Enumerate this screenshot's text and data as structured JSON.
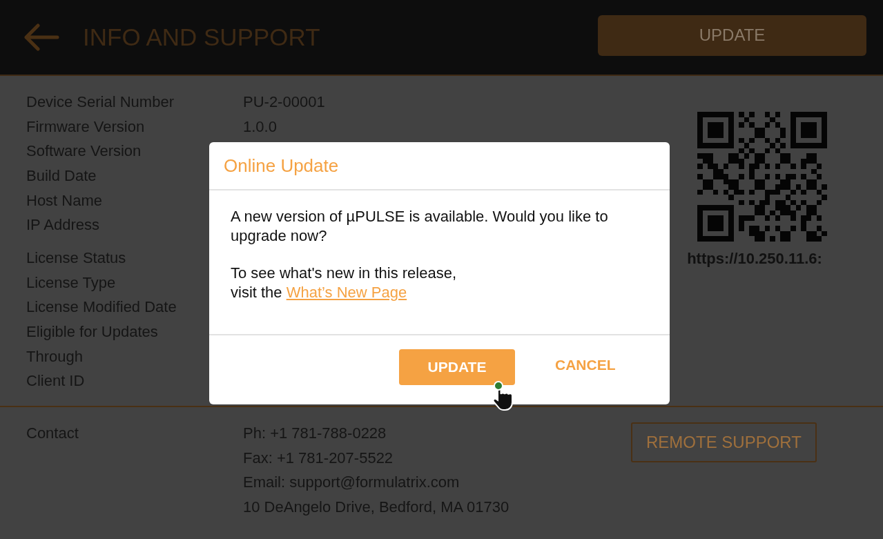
{
  "header": {
    "title": "INFO AND SUPPORT",
    "update_button": "UPDATE"
  },
  "info_groups": [
    [
      {
        "label": "Device Serial Number",
        "value": "PU-2-00001"
      },
      {
        "label": "Firmware Version",
        "value": "1.0.0"
      },
      {
        "label": "Software Version"
      },
      {
        "label": "Build Date"
      },
      {
        "label": "Host Name"
      },
      {
        "label": "IP Address"
      }
    ],
    [
      {
        "label": "License Status"
      },
      {
        "label": "License Type"
      },
      {
        "label": "License Modified Date"
      },
      {
        "label": "Eligible for Updates"
      },
      {
        "label": "Through"
      },
      {
        "label": "Client ID"
      }
    ]
  ],
  "qr": {
    "url": "https://10.250.11.6:"
  },
  "contact": {
    "label": "Contact",
    "lines": [
      "Ph: +1 781-788-0228",
      "Fax: +1 781-207-5522",
      "Email: support@formulatrix.com",
      "10 DeAngelo Drive, Bedford, MA 01730"
    ],
    "remote_support_button": "REMOTE SUPPORT"
  },
  "dialog": {
    "title": "Online Update",
    "message": "A new version of µPULSE is available. Would you like to upgrade now?",
    "note": "To see what's new in this release,",
    "link_prefix": "visit the ",
    "link": "What’s New Page",
    "buttons": [
      {
        "label": "UPDATE",
        "kind": "primary"
      },
      {
        "label": "CANCEL",
        "kind": "text"
      }
    ]
  }
}
